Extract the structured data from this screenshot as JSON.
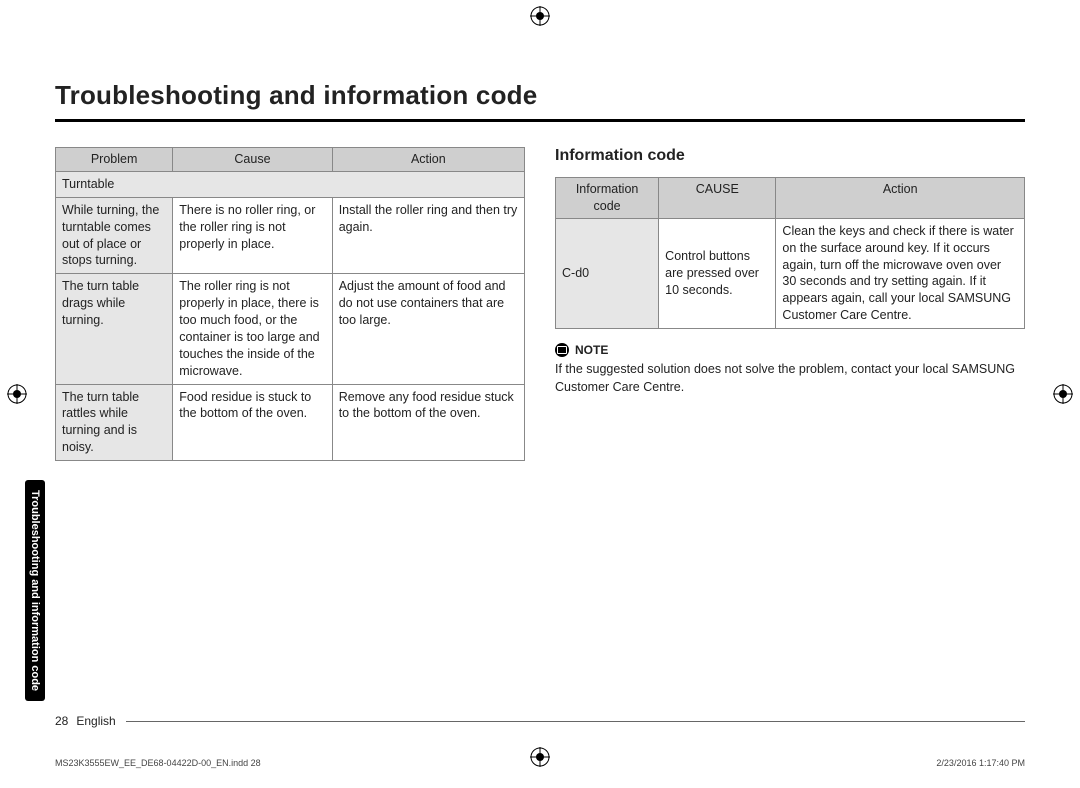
{
  "title": "Troubleshooting and information code",
  "left": {
    "headers": [
      "Problem",
      "Cause",
      "Action"
    ],
    "subheader": "Turntable",
    "rows": [
      {
        "problem": "While turning, the turntable comes out of place or stops turning.",
        "cause": "There is no roller ring, or the roller ring is not properly in place.",
        "action": "Install the roller ring and then try again."
      },
      {
        "problem": "The turn table drags while turning.",
        "cause": "The roller ring is not properly in place, there is too much food, or the container is too large and touches the inside of the microwave.",
        "action": "Adjust the amount of food and do not use containers that are too large."
      },
      {
        "problem": "The turn table rattles while turning and is noisy.",
        "cause": "Food residue is stuck to the bottom of the oven.",
        "action": "Remove any food residue stuck to the bottom of the oven."
      }
    ]
  },
  "right": {
    "section_title": "Information code",
    "headers": [
      "Information code",
      "CAUSE",
      "Action"
    ],
    "row": {
      "code": "C-d0",
      "cause": "Control buttons are pressed over 10 seconds.",
      "action": "Clean the keys and check if there is water on the surface around key. If it occurs again, turn off the microwave oven over 30 seconds and try setting again. If it appears again, call your local SAMSUNG Customer Care Centre."
    },
    "note_label": "NOTE",
    "note_text": "If the suggested solution does not solve the problem, contact your local SAMSUNG Customer Care Centre."
  },
  "side_tab": "Troubleshooting and information code",
  "footer": {
    "page": "28",
    "lang": "English"
  },
  "meta": {
    "file": "MS23K3555EW_EE_DE68-04422D-00_EN.indd   28",
    "stamp": "2/23/2016   1:17:40 PM"
  }
}
